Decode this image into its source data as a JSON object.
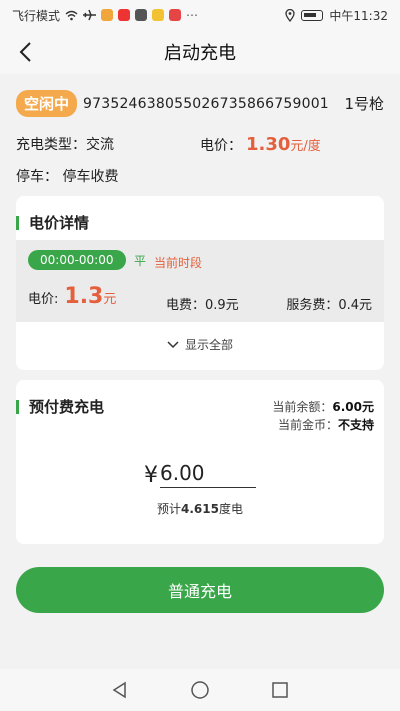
{
  "status_bar": {
    "mode_text": "飞行模式",
    "time": "中午11:32"
  },
  "header": {
    "title": "启动充电"
  },
  "station": {
    "status_badge": "空闲中",
    "device_id": "973524638055026735866759001",
    "gun_label": "1号枪",
    "charge_type_label": "充电类型：",
    "charge_type_value": "交流",
    "price_label": "电价：",
    "price_value": "1.30",
    "price_unit": "元/度",
    "parking_label": "停车：",
    "parking_value": "停车收费"
  },
  "price_details": {
    "title": "电价详情",
    "period_time": "00:00-00:00",
    "period_type": "平",
    "current_period_label": "当前时段",
    "price_label": "电价:",
    "price_value": "1.3",
    "price_unit": "元",
    "electric_fee": "电费：0.9元",
    "service_fee": "服务费：0.4元",
    "show_all": "显示全部"
  },
  "prepay": {
    "title": "预付费充电",
    "balance_label": "当前余额：",
    "balance_value": "6.00元",
    "coins_label": "当前金币：",
    "coins_value": "不支持",
    "currency_symbol": "¥",
    "amount_value": "6.00",
    "estimate_prefix": "预计",
    "estimate_value": "4.615",
    "estimate_suffix": "度电"
  },
  "actions": {
    "charge_button": "普通充电"
  },
  "colors": {
    "accent_green": "#3aa64a",
    "price_red": "#e45f3b",
    "badge_orange": "#f4a94d"
  }
}
